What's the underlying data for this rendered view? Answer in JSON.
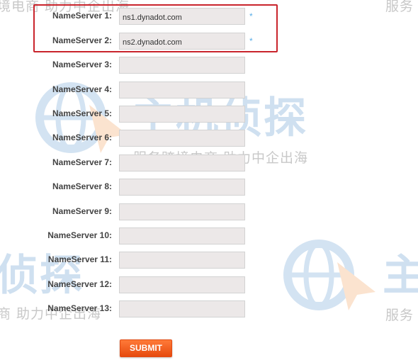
{
  "watermark": {
    "brand": "主机侦探",
    "slogan": "服务跨境电商 助力中企出海",
    "fragments": {
      "top_left": "境电商 助力中企出海",
      "top_right": "服务",
      "left_big": "侦探",
      "left_slogan": "商 助力中企出海",
      "right_big": "主",
      "right_slogan": "服务"
    }
  },
  "form": {
    "rows": [
      {
        "label": "NameServer 1:",
        "value": "ns1.dynadot.com",
        "required_mark": "*"
      },
      {
        "label": "NameServer 2:",
        "value": "ns2.dynadot.com",
        "required_mark": "*"
      },
      {
        "label": "NameServer 3:",
        "value": ""
      },
      {
        "label": "NameServer 4:",
        "value": ""
      },
      {
        "label": "NameServer 5:",
        "value": ""
      },
      {
        "label": "NameServer 6:",
        "value": ""
      },
      {
        "label": "NameServer 7:",
        "value": ""
      },
      {
        "label": "NameServer 8:",
        "value": ""
      },
      {
        "label": "NameServer 9:",
        "value": ""
      },
      {
        "label": "NameServer 10:",
        "value": ""
      },
      {
        "label": "NameServer 11:",
        "value": ""
      },
      {
        "label": "NameServer 12:",
        "value": ""
      },
      {
        "label": "NameServer 13:",
        "value": ""
      }
    ],
    "submit_label": "SUBMIT"
  },
  "colors": {
    "highlight_border": "#c9242c",
    "required_mark": "#5aaee8",
    "submit_button": "#f05a1a",
    "input_background": "#ece8e8"
  }
}
